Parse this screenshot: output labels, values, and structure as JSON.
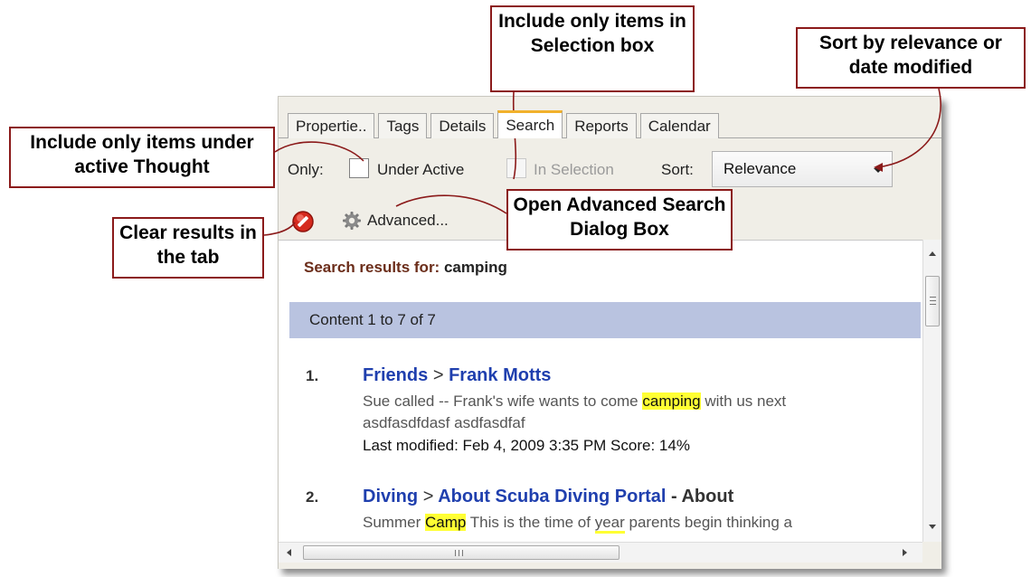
{
  "tabs": [
    {
      "label": "Propertie..",
      "active": false
    },
    {
      "label": "Tags",
      "active": false
    },
    {
      "label": "Details",
      "active": false
    },
    {
      "label": "Search",
      "active": true
    },
    {
      "label": "Reports",
      "active": false
    },
    {
      "label": "Calendar",
      "active": false
    }
  ],
  "options": {
    "only_label": "Only:",
    "under_active_label": "Under Active",
    "in_selection_label": "In Selection",
    "sort_label": "Sort:",
    "sort_value": "Relevance"
  },
  "toolbar": {
    "clear_icon": "clear-results-icon",
    "advanced_icon": "gear-icon",
    "advanced_label": "Advanced..."
  },
  "results": {
    "title_prefix": "Search results for:",
    "query": "camping",
    "count_text": "Content 1 to 7 of 7",
    "items": [
      {
        "num": "1.",
        "crumb_parent": "Friends",
        "crumb_sep": ">",
        "crumb_child": "Frank Motts",
        "crumb_suffix": "",
        "snippet_before": "Sue called -- Frank's wife wants to come ",
        "snippet_highlight": "camping",
        "snippet_after": " with us next",
        "snippet_line2": "asdfasdfdasf asdfasdfaf",
        "meta": "Last modified: Feb 4, 2009 3:35 PM   Score: 14%"
      },
      {
        "num": "2.",
        "crumb_parent": "Diving",
        "crumb_sep": ">",
        "crumb_child": "About Scuba Diving Portal",
        "crumb_suffix": " - About",
        "snippet_before": "Summer ",
        "snippet_highlight": "Camp",
        "snippet_mid": " This is the time of ",
        "snippet_underlined": "year",
        "snippet_after": " parents begin thinking a"
      }
    ]
  },
  "scrollbar_icons": {
    "up": "scroll-up-arrow-icon",
    "down": "scroll-down-arrow-icon",
    "left": "scroll-left-arrow-icon",
    "right": "scroll-right-arrow-icon"
  },
  "callouts": {
    "selection": "Include only items in Selection box",
    "sort": "Sort by relevance or date modified",
    "active": "Include only items under active Thought",
    "advanced": "Open Advanced Search Dialog Box",
    "clear": "Clear results in the tab"
  },
  "colors": {
    "callout_border": "#8b1a1a",
    "active_tab_accent": "#f1b12c",
    "count_bar": "#b9c3e0",
    "link": "#1f3fae",
    "highlight": "#ffff33"
  }
}
